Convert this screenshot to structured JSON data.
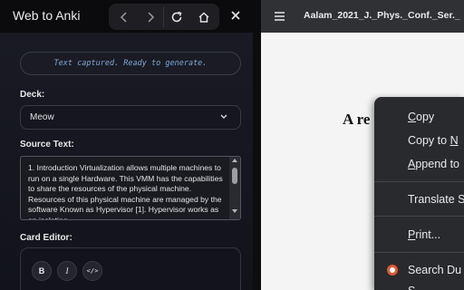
{
  "panel": {
    "title": "Web to Anki",
    "status": "Text captured. Ready to generate.",
    "deck_label": "Deck:",
    "deck_value": "Meow",
    "source_label": "Source Text:",
    "source_text": "1. Introduction Virtualization allows multiple machines to run on a single Hardware. This VMM has the capabilities to share the resources of the physical machine. Resources of this physical machine are managed by the software Known as Hypervisor [1]. Hypervisor works as an isolating",
    "editor_label": "Card Editor:",
    "format_buttons": {
      "bold": "B",
      "italic": "I",
      "code": "</>"
    }
  },
  "viewer": {
    "doc_title": "Aalam_2021_J._Phys._Conf._Ser._",
    "page_heading": "A re"
  },
  "context_menu": {
    "items": [
      {
        "lead": "",
        "ul": "C",
        "tail": "opy"
      },
      {
        "lead": "Copy to ",
        "ul": "N",
        "tail": ""
      },
      {
        "lead": "",
        "ul": "A",
        "tail": "ppend to"
      },
      {
        "lead": "Translate S",
        "ul": "",
        "tail": ""
      },
      {
        "lead": "",
        "ul": "P",
        "tail": "rint..."
      },
      {
        "lead": "Search Du",
        "ul": "",
        "tail": ""
      },
      {
        "lead": "S",
        "ul": "",
        "tail": ""
      }
    ]
  },
  "colors": {
    "accent_text": "#7fa9d8",
    "menu_bg": "#292a2d",
    "toolbar_bg": "#303134",
    "duckduckgo": "#de5833"
  }
}
